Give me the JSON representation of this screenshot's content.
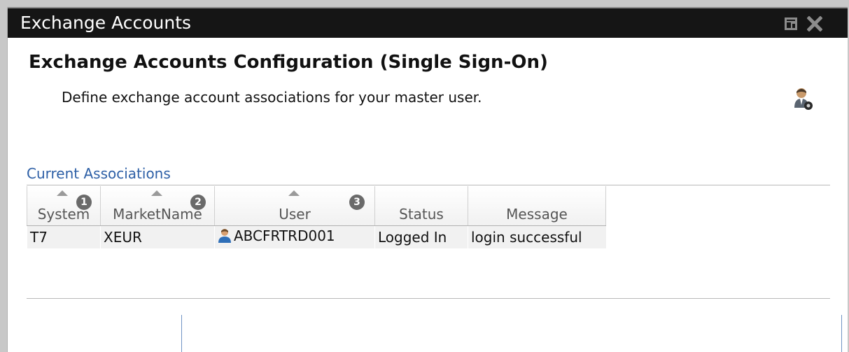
{
  "window": {
    "title": "Exchange Accounts"
  },
  "page": {
    "heading": "Exchange Accounts Configuration (Single Sign-On)",
    "subheading": "Define exchange account associations for your master user."
  },
  "associations": {
    "section_label": "Current Associations",
    "columns": [
      {
        "label": "System",
        "sortable": true,
        "badge": "1"
      },
      {
        "label": "MarketName",
        "sortable": true,
        "badge": "2"
      },
      {
        "label": "User",
        "sortable": true,
        "badge": "3"
      },
      {
        "label": "Status",
        "sortable": false,
        "badge": ""
      },
      {
        "label": "Message",
        "sortable": false,
        "badge": ""
      }
    ],
    "rows": [
      {
        "system": "T7",
        "market_name": "XEUR",
        "user": "ABCFRTRD001",
        "status": "Logged In",
        "message": "login successful"
      }
    ]
  },
  "icons": {
    "restore": "restore-icon",
    "close": "close-icon",
    "admin": "user-admin-icon",
    "user": "user-icon"
  },
  "colors": {
    "titlebar": "#151515",
    "section_label": "#2d5fa6",
    "badge": "#6a6a6a"
  }
}
